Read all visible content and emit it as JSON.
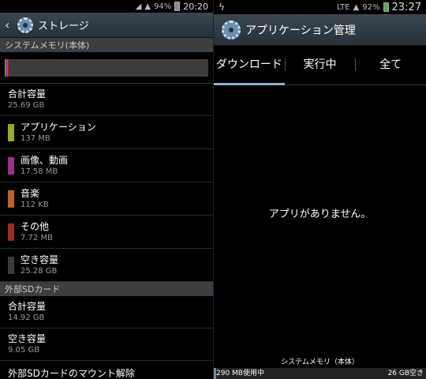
{
  "left": {
    "status": {
      "signal": "94%",
      "time": "20:20"
    },
    "title": "ストレージ",
    "system_memory_header": "システムメモリ(本体)",
    "storage_segments": [
      {
        "name": "applications",
        "color": "#9aa62a",
        "fraction": 0.005
      },
      {
        "name": "media",
        "color": "#9b2f8d",
        "fraction": 0.005
      },
      {
        "name": "audio",
        "color": "#c0612a",
        "fraction": 0.004
      },
      {
        "name": "other",
        "color": "#a02a2a",
        "fraction": 0.004
      },
      {
        "name": "free",
        "color": "#3c3c3c",
        "fraction": 0.982
      }
    ],
    "total": {
      "label": "合計容量",
      "value": "25.69 GB"
    },
    "items": [
      {
        "label": "アプリケーション",
        "value": "137 MB",
        "color": "#9aa62a"
      },
      {
        "label": "画像、動画",
        "value": "17.58 MB",
        "color": "#9b2f8d"
      },
      {
        "label": "音楽",
        "value": "112 KB",
        "color": "#c0612a"
      },
      {
        "label": "その他",
        "value": "7.72 MB",
        "color": "#a02a2a"
      },
      {
        "label": "空き容量",
        "value": "25.28 GB",
        "color": "#3a3a3a"
      }
    ],
    "sd_header": "外部SDカード",
    "sd_total": {
      "label": "合計容量",
      "value": "14.92 GB"
    },
    "sd_free": {
      "label": "空き容量",
      "value": "9.05 GB"
    },
    "sd_unmount": "外部SDカードのマウント解除"
  },
  "right": {
    "status": {
      "network": "LTE",
      "battery": "92%",
      "time": "23:27"
    },
    "title": "アプリケーション管理",
    "tabs": [
      "ダウンロード",
      "実行中",
      "全て"
    ],
    "empty_message": "アプリがありません。",
    "memory": {
      "title": "システムメモリ（本体）",
      "used": "290 MB使用中",
      "free": "26 GB空き",
      "used_fraction": 0.011
    }
  }
}
